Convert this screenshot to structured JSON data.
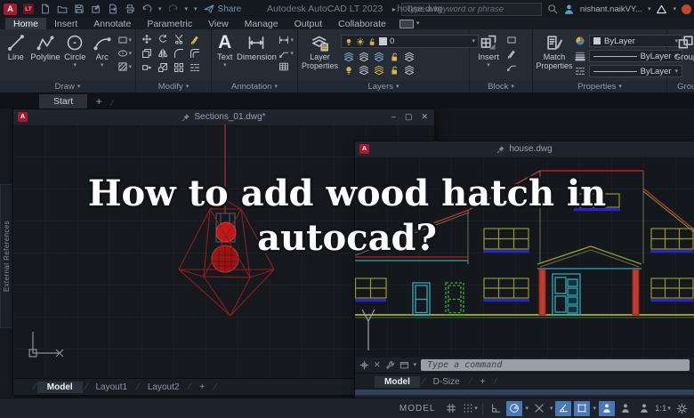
{
  "titlebar": {
    "app_badge": "A",
    "app_badge_sub": "LT",
    "share_label": "Share",
    "title_app": "Autodesk AutoCAD LT 2023",
    "title_doc": "house.dwg",
    "search_placeholder": "Type a keyword or phrase",
    "user_name": "nishant.naikVY..."
  },
  "ribbon": {
    "tabs": [
      {
        "label": "Home"
      },
      {
        "label": "Insert"
      },
      {
        "label": "Annotate"
      },
      {
        "label": "Parametric"
      },
      {
        "label": "View"
      },
      {
        "label": "Manage"
      },
      {
        "label": "Output"
      },
      {
        "label": "Collaborate"
      }
    ],
    "panels": {
      "draw": {
        "label": "Draw",
        "line": "Line",
        "polyline": "Polyline",
        "circle": "Circle",
        "arc": "Arc"
      },
      "modify": {
        "label": "Modify"
      },
      "annotation": {
        "label": "Annotation",
        "text": "Text",
        "dimension": "Dimension",
        "text_icon": "A"
      },
      "layers": {
        "label": "Layers",
        "layer_properties": "Layer Properties",
        "current_layer": "0"
      },
      "block": {
        "label": "Block",
        "insert": "Insert"
      },
      "properties": {
        "label": "Properties",
        "match_properties": "Match Properties",
        "color": "ByLayer",
        "lineweight": "ByLayer",
        "linetype": "ByLayer"
      },
      "groups": {
        "label": "Groups",
        "group": "Group"
      }
    }
  },
  "file_tabs": {
    "start": "Start",
    "new_tab": "+"
  },
  "side_panel": {
    "label": "External References"
  },
  "overlay": {
    "line1": "How to add wood hatch in",
    "line2": "autocad?"
  },
  "sections_window": {
    "title": "Sections_01.dwg*",
    "tabs": [
      "Model",
      "Layout1",
      "Layout2"
    ],
    "new_tab": "+"
  },
  "house_window": {
    "title": "house.dwg",
    "command_placeholder": "Type a command",
    "tabs": [
      "Model",
      "D-Size"
    ],
    "new_tab": "+"
  },
  "statusbar": {
    "model": "MODEL",
    "scale": "1:1"
  },
  "icons": {
    "caret": "▾",
    "close": "✕",
    "minimize": "–",
    "maximize": "▢",
    "plus": "+",
    "slash": "/",
    "arrow_right": "▸"
  },
  "colors": {
    "accent_blue": "#4a7ab5",
    "cad_red": "#b03030",
    "cad_olive": "#97972f",
    "cad_cyan": "#2fa8b8",
    "cad_green": "#2eae3a",
    "cad_blue": "#2626c0",
    "cmd_field_gray": "#9aa0a8"
  }
}
